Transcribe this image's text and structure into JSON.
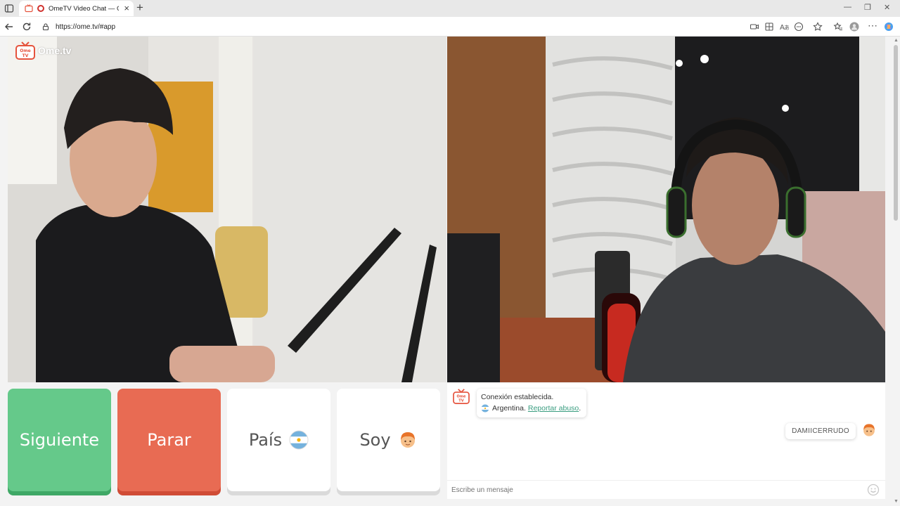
{
  "browser": {
    "tab_title": "OmeTV Video Chat — Omegle",
    "url": "https://ome.tv/#app"
  },
  "logo": {
    "text": "Ome.tv",
    "badge_text": "Ome TV"
  },
  "controls": {
    "next_label": "Siguiente",
    "stop_label": "Parar",
    "country_label": "País",
    "gender_label": "Soy"
  },
  "chat": {
    "system_line1": "Conexión establecida.",
    "country_name": "Argentina.",
    "report_link": "Reportar abuso",
    "report_suffix": ".",
    "user_name": "DAMIICERRUDO",
    "input_placeholder": "Escribe un mensaje"
  },
  "colors": {
    "next": "#65c98a",
    "stop": "#e86b53",
    "link": "#3a9d80"
  }
}
